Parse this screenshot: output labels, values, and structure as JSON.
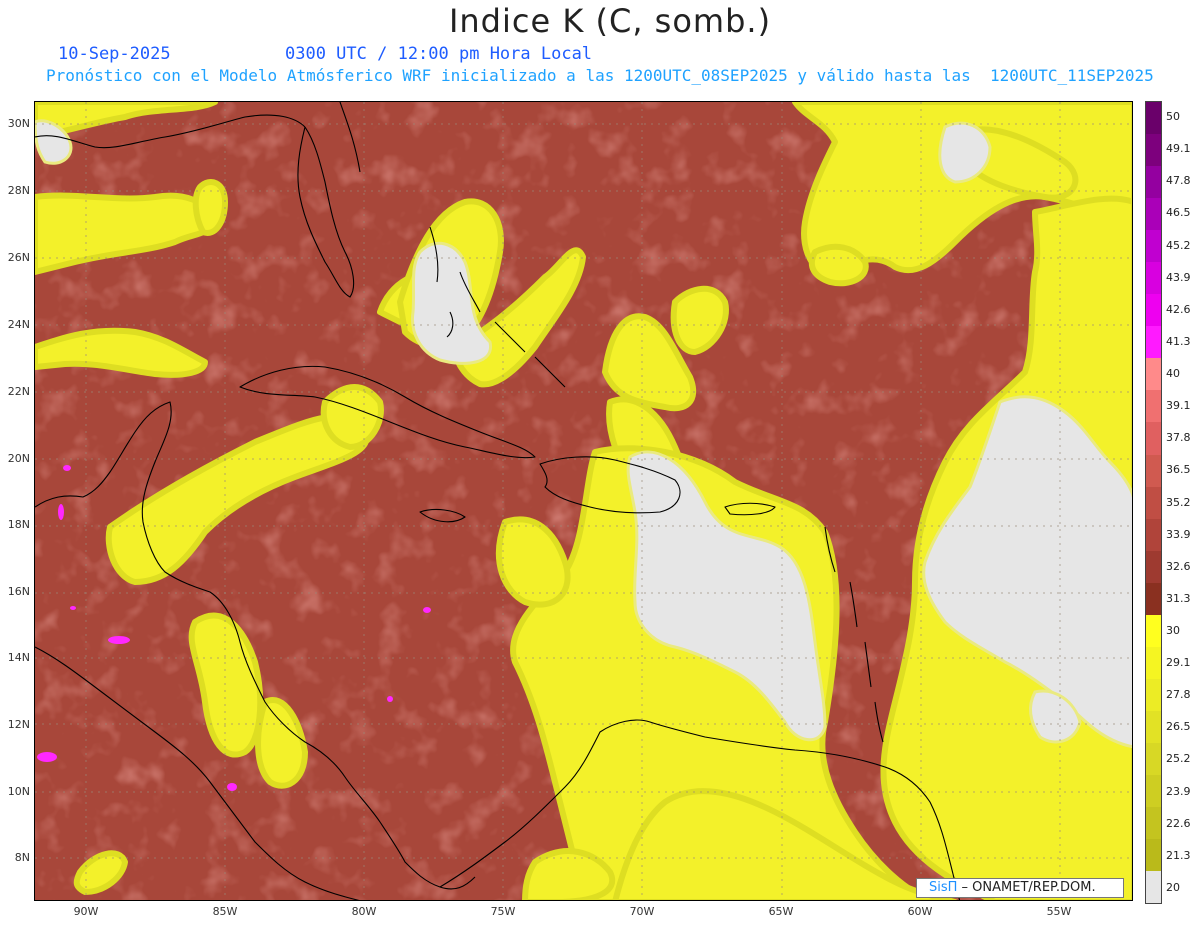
{
  "header": {
    "title": "Indice K (C, somb.)",
    "date": "10-Sep-2025",
    "time": "0300 UTC / 12:00 pm Hora Local",
    "forecast_info": "Pronóstico con el Modelo Atmósferico WRF inicializado a las 1200UTC_08SEP2025 y válido hasta las  1200UTC_11SEP2025"
  },
  "map": {
    "lat_labels": [
      "30N",
      "28N",
      "26N",
      "24N",
      "22N",
      "20N",
      "18N",
      "16N",
      "14N",
      "12N",
      "10N",
      "8N"
    ],
    "lon_labels": [
      "90W",
      "85W",
      "80W",
      "75W",
      "70W",
      "65W",
      "60W",
      "55W"
    ],
    "colors": {
      "background_fill": "#a8473a",
      "moist_band": "#f3f12a",
      "dry_area": "#e6e6e6",
      "coastline": "#000000"
    }
  },
  "colorbar": {
    "labels": [
      "50",
      "49.1",
      "47.8",
      "46.5",
      "45.2",
      "43.9",
      "42.6",
      "41.3",
      "40",
      "39.1",
      "37.8",
      "36.5",
      "35.2",
      "33.9",
      "32.6",
      "31.3",
      "30",
      "29.1",
      "27.8",
      "26.5",
      "25.2",
      "23.9",
      "22.6",
      "21.3",
      "20"
    ],
    "colors": [
      "#6a006a",
      "#7d007d",
      "#9400a0",
      "#aa00b8",
      "#c000d0",
      "#d800e0",
      "#ee00f0",
      "#ff1aff",
      "#ff8a8a",
      "#f07070",
      "#e06060",
      "#d05a50",
      "#c04e44",
      "#b0443a",
      "#9e3a30",
      "#8a3020",
      "#ffff1f",
      "#f5f522",
      "#ecec25",
      "#e2e225",
      "#d8d825",
      "#cece22",
      "#c4c41f",
      "#baba1a",
      "#e6e6e6"
    ]
  },
  "credit": {
    "brand": "SisΠ",
    "rest": " – ONAMET/REP.DOM."
  }
}
